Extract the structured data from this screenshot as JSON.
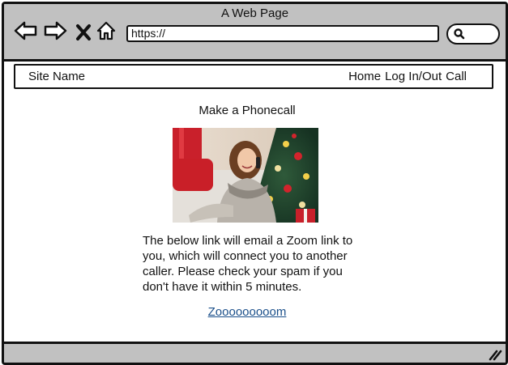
{
  "window": {
    "title": "A Web Page",
    "url": "https://"
  },
  "icons": {
    "back": "back-arrow-icon",
    "forward": "forward-arrow-icon",
    "close": "close-icon",
    "home": "home-icon",
    "search": "search-icon",
    "resize": "resize-grip-icon"
  },
  "site_nav": {
    "site_name": "Site Name",
    "links": [
      "Home",
      "Log In/Out",
      "Call"
    ]
  },
  "main": {
    "title": "Make a Phonecall",
    "description": "The below link will email a Zoom link to you, which will connect you to another caller. Please check your spam if you don't have it within 5 minutes.",
    "link_text": "Zooooooooom"
  },
  "colors": {
    "chrome": "#c1c1c1",
    "border": "#111111",
    "link": "#1a4f8a"
  }
}
